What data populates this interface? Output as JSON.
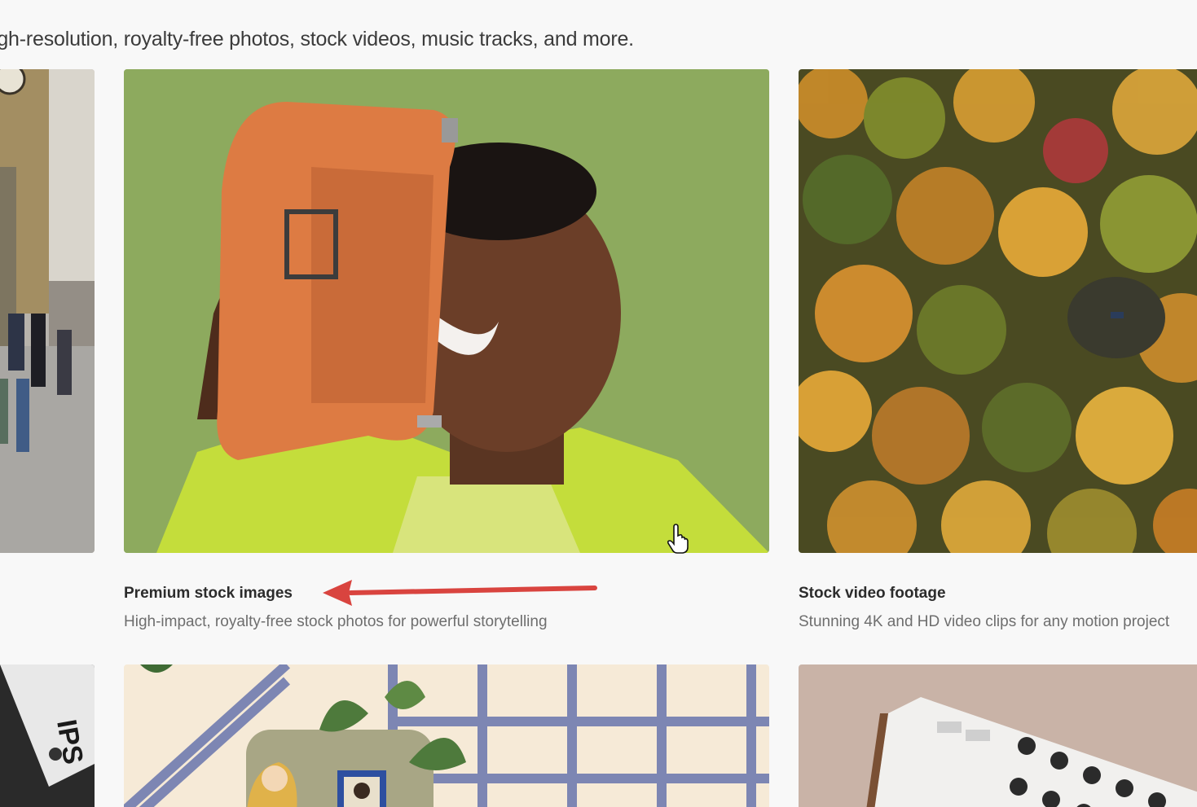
{
  "intro": {
    "text": "igh-resolution, royalty-free photos, stock videos, music tracks, and more."
  },
  "cards": [
    {
      "title": "Premium stock images",
      "description": "High-impact, royalty-free stock photos for powerful storytelling",
      "image": "woman-orange-bag-photo"
    },
    {
      "title": "Stock video footage",
      "description": "Stunning 4K and HD video clips for any motion project",
      "image": "autumn-forest-aerial-photo"
    }
  ],
  "partial_tiles": {
    "left_top": "london-street-photo",
    "left_bottom": "packaging-mockup-photo",
    "middle_bottom": "illustration-plants-grid",
    "right_bottom": "audio-mixer-photo"
  },
  "annotation": {
    "arrow_color": "#d9443f",
    "cursor": "hand-pointer-icon"
  }
}
